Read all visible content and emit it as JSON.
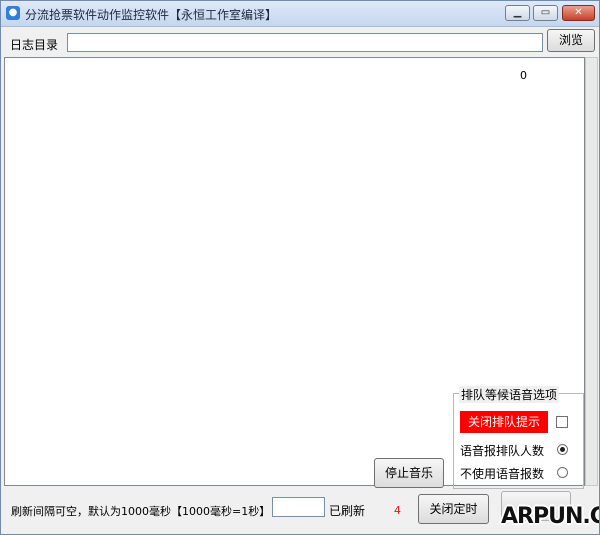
{
  "window": {
    "title": "分流抢票软件动作监控软件【永恒工作室编译】",
    "min_glyph": "▁",
    "max_glyph": "▭",
    "close_glyph": "✕"
  },
  "toolbar": {
    "path_label": "日志目录",
    "path_value": "",
    "browse_label": "浏览"
  },
  "log": {
    "counter": "0"
  },
  "voice_options": {
    "group_title": "排队等候语音选项",
    "queue_toggle_label": "关闭排队提示",
    "queue_toggle_color": "#ff0000",
    "checkbox_checked": false,
    "option_count_label": "语音报排队人数",
    "option_count_selected": true,
    "option_off_label": "不使用语音报数",
    "option_off_selected": false
  },
  "controls": {
    "stop_music_label": "停止音乐",
    "interval_label": "刷新间隔可空，默认为1000毫秒【1000毫秒=1秒】",
    "interval_value": "",
    "refreshed_label": "已刷新",
    "refresh_count": "4",
    "refresh_count_color": "#e01010",
    "close_timer_label": "关闭定时"
  },
  "watermark": {
    "text": "ARPUN.COM"
  }
}
